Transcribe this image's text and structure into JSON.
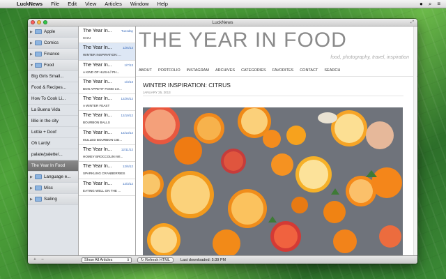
{
  "menubar": {
    "app": "LuckNews",
    "items": [
      "File",
      "Edit",
      "View",
      "Articles",
      "Window",
      "Help"
    ]
  },
  "window": {
    "title": "LuckNews"
  },
  "sources": [
    {
      "label": "Apple",
      "type": "group",
      "expanded": false
    },
    {
      "label": "Comics",
      "type": "group",
      "expanded": false
    },
    {
      "label": "Finance",
      "type": "group",
      "expanded": false
    },
    {
      "label": "Food",
      "type": "group",
      "expanded": true
    },
    {
      "label": "Big Girls Small...",
      "type": "leaf"
    },
    {
      "label": "Food & Recipes...",
      "type": "leaf"
    },
    {
      "label": "How To Cook Li...",
      "type": "leaf"
    },
    {
      "label": "La Buena Vida",
      "type": "leaf"
    },
    {
      "label": "lillie in the city",
      "type": "leaf"
    },
    {
      "label": "Lottie + Doof",
      "type": "leaf"
    },
    {
      "label": "Oh Lardy!",
      "type": "leaf"
    },
    {
      "label": "palate/palette/...",
      "type": "leaf"
    },
    {
      "label": "The Year In Food",
      "type": "leaf",
      "selected": true
    },
    {
      "label": "Language e...",
      "type": "group",
      "expanded": false
    },
    {
      "label": "Misc",
      "type": "group",
      "expanded": false
    },
    {
      "label": "Sailing",
      "type": "group",
      "expanded": false
    }
  ],
  "articles": [
    {
      "title": "The Year In...",
      "date": "Tuesday",
      "summary": "CHAI"
    },
    {
      "title": "The Year In...",
      "date": "1/25/13",
      "summary": "WINTER INSPIRATION: ...",
      "selected": true
    },
    {
      "title": "The Year In...",
      "date": "1/7/13",
      "summary": "A KIND OF HUSH // PH..."
    },
    {
      "title": "The Year In...",
      "date": "1/3/13",
      "summary": "BON APPETIT FOOD LO..."
    },
    {
      "title": "The Year In...",
      "date": "12/26/12",
      "summary": "A WINTER FEAST"
    },
    {
      "title": "The Year In...",
      "date": "12/19/12",
      "summary": "BOURBON BALLS"
    },
    {
      "title": "The Year In...",
      "date": "12/13/12",
      "summary": "MULLED BOURBON CID..."
    },
    {
      "title": "The Year In...",
      "date": "12/11/12",
      "summary": "HOMEY BROCCOLINI WI..."
    },
    {
      "title": "The Year In...",
      "date": "12/6/12",
      "summary": "SPARKLING CRANBERRIES"
    },
    {
      "title": "The Year In...",
      "date": "12/3/12",
      "summary": "EATING WELL ON THE ..."
    }
  ],
  "content": {
    "blog_title": "THE YEAR IN FOOD",
    "tagline": "food, photography, travel, inspiration",
    "nav": [
      "ABOUT",
      "PORTFOLIO",
      "INSTAGRAM",
      "ARCHIVES",
      "CATEGORIES",
      "FAVORITES",
      "CONTACT",
      "SEARCH"
    ],
    "post_title": "WINTER INSPIRATION: CITRUS",
    "post_date": "JANUARY 25, 2013"
  },
  "bottombar": {
    "add": "+",
    "remove": "–",
    "filter": "Show All Articles",
    "refresh": "Refresh HTML",
    "status": "Last downloaded: 5:39 PM"
  },
  "colors": {
    "accent": "#3b6dbd",
    "selection": "#7d7d7d",
    "citrus": "#f28a1c"
  }
}
